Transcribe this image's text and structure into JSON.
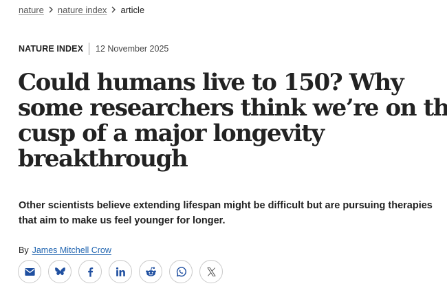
{
  "breadcrumb": {
    "items": [
      {
        "label": "nature"
      },
      {
        "label": "nature index"
      },
      {
        "label": "article"
      }
    ]
  },
  "meta": {
    "article_type": "NATURE INDEX",
    "date": "12 November 2025"
  },
  "headline": {
    "lines": [
      "Could humans live to 150? Why",
      "some researchers think we’re on the",
      "cusp of a major longevity",
      "breakthrough"
    ]
  },
  "standfirst": {
    "lines": [
      "Other scientists believe extending lifespan might be difficult but are pursuing therapies",
      "that aim to make us feel younger for longer."
    ]
  },
  "byline": {
    "prefix": "By",
    "author": "James Mitchell Crow"
  },
  "share": {
    "icons": [
      "email-icon",
      "bluesky-icon",
      "facebook-icon",
      "linkedin-icon",
      "reddit-icon",
      "whatsapp-icon",
      "x-icon"
    ],
    "icon_color": "#1f4fa0",
    "x_color": "#555555"
  },
  "colors": {
    "text": "#222222",
    "link": "#1f64b0",
    "share_icon": "#1f4fa0"
  }
}
